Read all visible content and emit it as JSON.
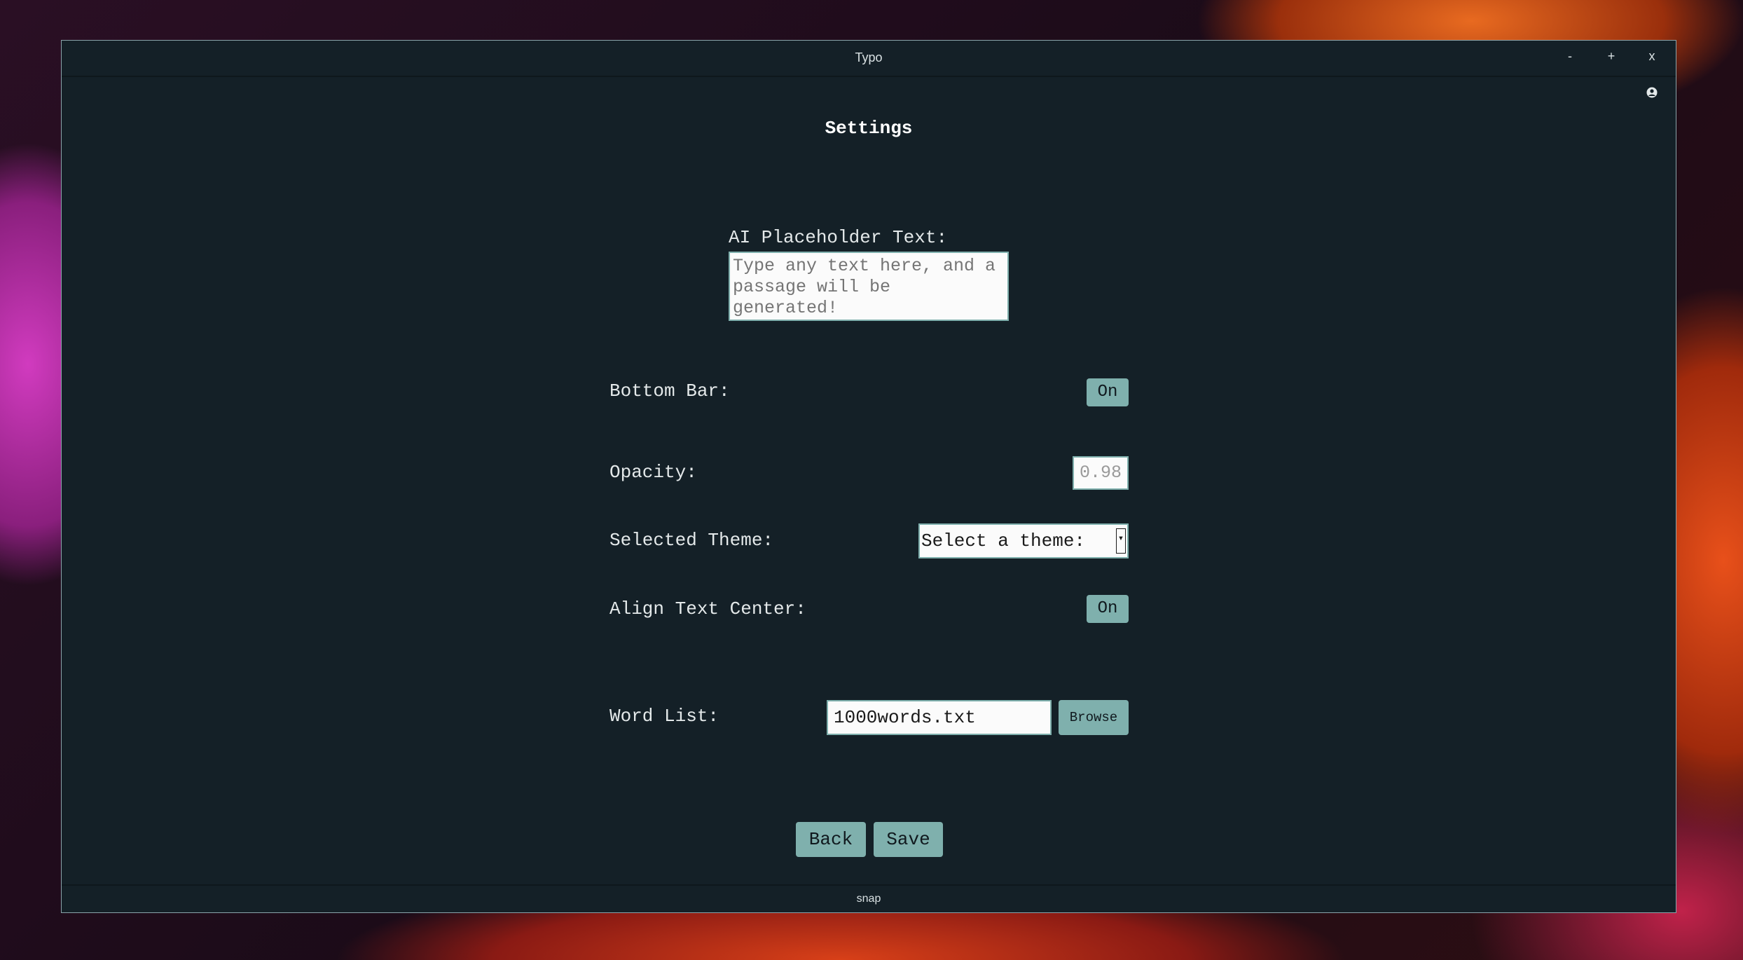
{
  "window": {
    "title": "Typo",
    "controls": {
      "minimize": "-",
      "maximize": "+",
      "close": "x"
    },
    "user_icon": "user-circle-icon"
  },
  "settings": {
    "heading": "Settings",
    "ai_placeholder": {
      "label": "AI Placeholder Text:",
      "placeholder": "Type any text here, and a passage will be generated!"
    },
    "bottom_bar": {
      "label": "Bottom Bar:",
      "value": "On"
    },
    "opacity": {
      "label": "Opacity:",
      "value": "0.98"
    },
    "theme": {
      "label": "Selected Theme:",
      "value": "Select a theme:"
    },
    "align_center": {
      "label": "Align Text Center:",
      "value": "On"
    },
    "word_list": {
      "label": "Word List:",
      "value": "1000words.txt",
      "browse_label": "Browse"
    }
  },
  "actions": {
    "back_label": "Back",
    "save_label": "Save"
  },
  "statusbar": {
    "text": "snap"
  },
  "colors": {
    "window_bg": "#142027",
    "accent": "#7fb0ad",
    "text": "#e4e9ea"
  }
}
